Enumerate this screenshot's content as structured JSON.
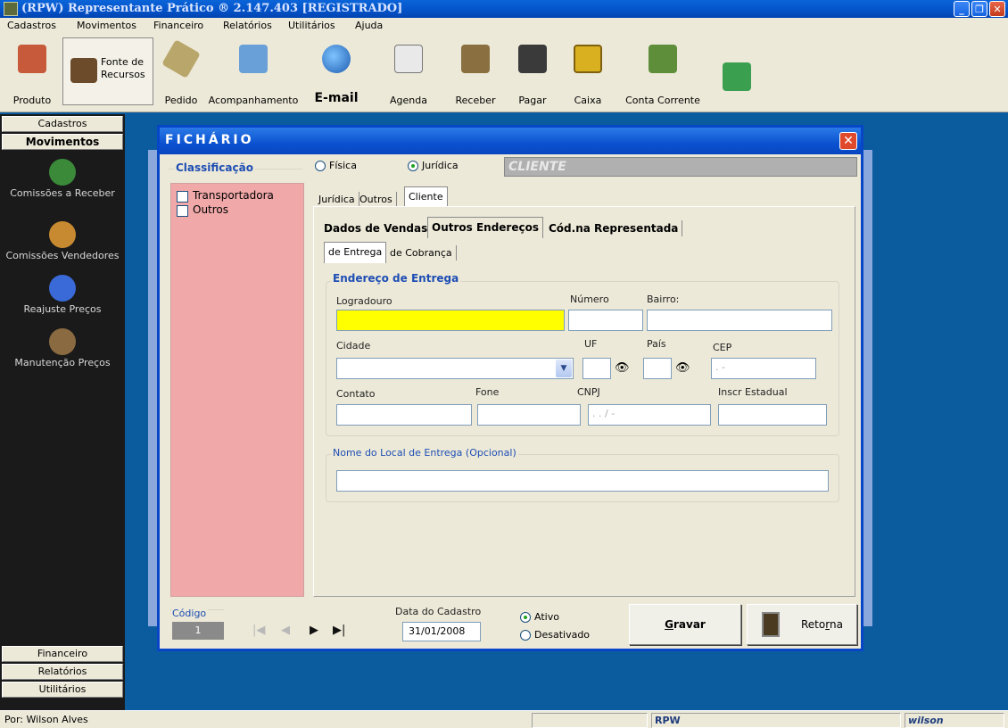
{
  "window": {
    "title": "(RPW) Representante Prático ® 2.147.403 [REGISTRADO]",
    "minimize": "_",
    "restore": "❐",
    "close": "✕"
  },
  "menu": [
    "Cadastros",
    "Movimentos",
    "Financeiro",
    "Relatórios",
    "Utilitários",
    "Ajuda"
  ],
  "toolbar": [
    {
      "label": "Produto",
      "icon": "product-icon"
    },
    {
      "label": "Fonte de\nRecursos",
      "icon": "resources-icon"
    },
    {
      "label": "Pedido",
      "icon": "order-icon"
    },
    {
      "label": "Acompanhamento",
      "icon": "tracking-icon"
    },
    {
      "label": "E-mail",
      "icon": "email-globe-icon"
    },
    {
      "label": "Agenda",
      "icon": "calendar-icon"
    },
    {
      "label": "Receber",
      "icon": "receive-icon"
    },
    {
      "label": "Pagar",
      "icon": "pay-icon"
    },
    {
      "label": "Caixa",
      "icon": "safe-icon"
    },
    {
      "label": "Conta Corrente",
      "icon": "account-icon"
    },
    {
      "label": "",
      "icon": "exit-door-icon"
    }
  ],
  "sidebar": {
    "top_sections": [
      "Cadastros",
      "Movimentos"
    ],
    "items": [
      {
        "label": "Comissões a Receber",
        "icon": "money-bag-icon"
      },
      {
        "label": "Comissões Vendedores",
        "icon": "salesman-icon"
      },
      {
        "label": "Reajuste Preços",
        "icon": "price-adjust-icon"
      },
      {
        "label": "Manutenção Preços",
        "icon": "price-maintenance-icon"
      }
    ],
    "bottom_sections": [
      "Financeiro",
      "Relatórios",
      "Utilitários"
    ]
  },
  "statusbar": {
    "user": "Por: Wilson Alves",
    "app": "RPW",
    "login": "wilson"
  },
  "dialog": {
    "title": "FICHÁRIO",
    "close": "✕",
    "classification": {
      "legend": "Classificação",
      "items": [
        "Transportadora",
        "Outros"
      ]
    },
    "person_type": {
      "fisica": "Física",
      "juridica": "Jurídica",
      "selected": "Jurídica"
    },
    "header_label": "CLIENTE",
    "main_tabs": [
      "Jurídica",
      "Outros",
      "Cliente"
    ],
    "sub_tabs": [
      "Dados de Vendas",
      "Outros Endereços",
      "Cód.na Representada"
    ],
    "addr_tabs": [
      "de Entrega",
      "de Cobrança"
    ],
    "delivery": {
      "legend": "Endereço de Entrega",
      "logradouro": "Logradouro",
      "numero": "Número",
      "bairro": "Bairro:",
      "cidade": "Cidade",
      "uf": "UF",
      "pais": "País",
      "cep": "CEP",
      "cep_mask": ".   -",
      "contato": "Contato",
      "fone": "Fone",
      "cnpj": "CNPJ",
      "cnpj_mask": ".  .   /    -",
      "inscr": "Inscr Estadual"
    },
    "local": {
      "legend": "Nome do Local de Entrega (Opcional)"
    },
    "codigo": {
      "label": "Código",
      "value": "1"
    },
    "data_cadastro": {
      "label": "Data do Cadastro",
      "value": "31/01/2008"
    },
    "status": {
      "ativo": "Ativo",
      "desativado": "Desativado",
      "selected": "Ativo"
    },
    "save": {
      "pre": "",
      "underline": "G",
      "post": "ravar"
    },
    "back": {
      "pre": "Reto",
      "underline": "r",
      "post": "na"
    }
  },
  "colors": {
    "desktop": "#0a5c9e",
    "pink_panel": "#f0a8a8",
    "required_field": "#ffff00",
    "title_blue": "#0846c8"
  }
}
